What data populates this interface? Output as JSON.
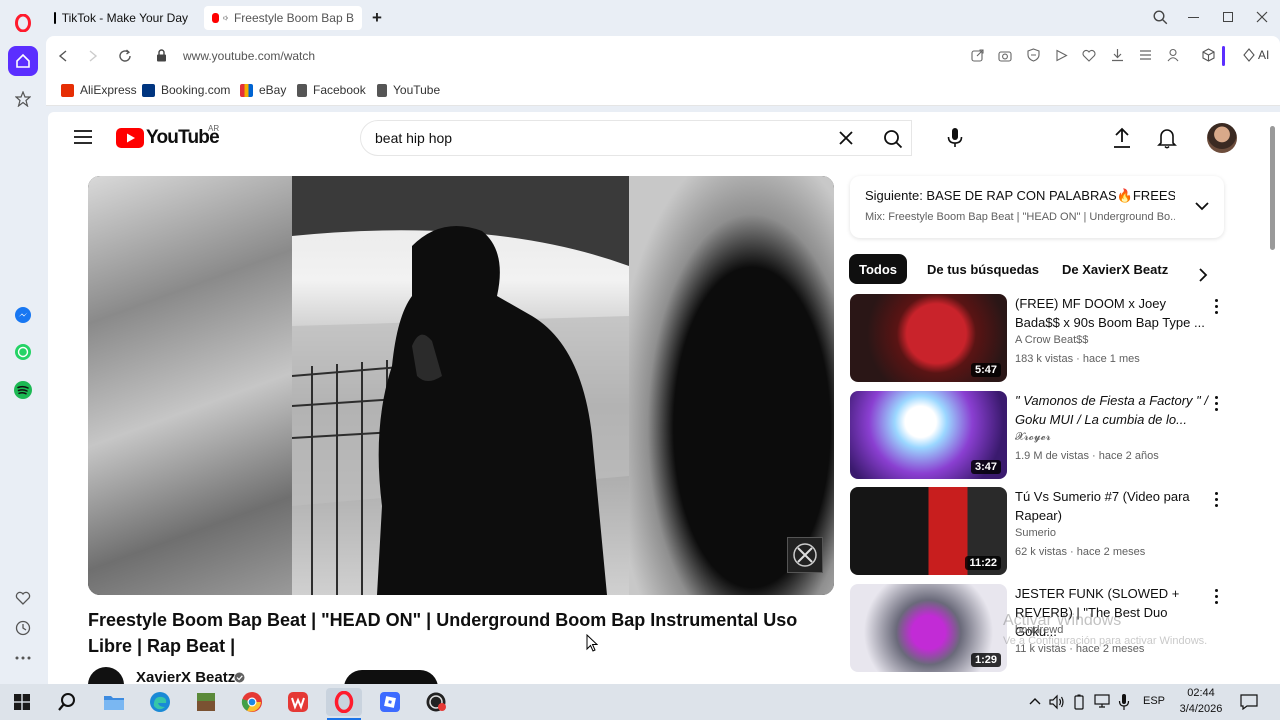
{
  "browser": {
    "tabs": [
      {
        "title": "TikTok - Make Your Day",
        "active": false
      },
      {
        "title": "Freestyle Boom Bap B",
        "active": true
      }
    ],
    "new_tab_symbol": "+",
    "url": "www.youtube.com/watch",
    "ai_label": "AI",
    "bookmarks": [
      {
        "label": "AliExpress",
        "color": "#e62e04"
      },
      {
        "label": "Booking.com",
        "color": "#003580"
      },
      {
        "label": "eBay",
        "color": "#e53238"
      },
      {
        "label": "Facebook",
        "color": "#555555"
      },
      {
        "label": "YouTube",
        "color": "#555555"
      }
    ]
  },
  "youtube": {
    "logo_text": "YouTube",
    "region": "AR",
    "search_value": "beat hip hop",
    "video_title": "Freestyle Boom Bap Beat | \"HEAD ON\" | Underground Boom Bap Instrumental Uso Libre | Rap Beat |",
    "channel_name": "XavierX Beatz",
    "next_up": {
      "label": "Siguiente: BASE DE RAP CON PALABRAS🔥FREEST...",
      "mix": "Mix: Freestyle Boom Bap Beat | \"HEAD ON\" | Underground Bo..."
    },
    "chips": [
      "Todos",
      "De tus búsquedas",
      "De XavierX Beatz"
    ],
    "recommendations": [
      {
        "title": "(FREE) MF DOOM x Joey Bada$$ x 90s Boom Bap Type ...",
        "channel": "A Crow Beat$$",
        "meta": "183 k vistas · hace 1 mes",
        "duration": "5:47",
        "colors": [
          "#2a1616",
          "#c9232b"
        ]
      },
      {
        "title": "\" Vamonos de Fiesta a Factory \" / Goku MUI / La cumbia de lo...",
        "channel": "𝓧𝓻𝓸𝔂𝓮𝓻",
        "meta": "1.9 M de vistas · hace 2 años",
        "duration": "3:47",
        "colors": [
          "#3a1a6e",
          "#9bd7ff"
        ]
      },
      {
        "title": "Tú Vs Sumerio #7 (Video para Rapear)",
        "channel": "Sumerio",
        "meta": "62 k vistas · hace 2 meses",
        "duration": "11:22",
        "colors": [
          "#111111",
          "#c81e1e"
        ]
      },
      {
        "title": "JESTER FUNK (SLOWED + REVERB) | \"The Best Duo Goku...",
        "channel": "bondrewd",
        "meta": "11 k vistas · hace 2 meses",
        "duration": "1:29",
        "colors": [
          "#e8e6ee",
          "#c22bd6"
        ]
      }
    ]
  },
  "watermark": {
    "line1": "Activar Windows",
    "line2": "Ve a Configuración para activar Windows."
  },
  "taskbar": {
    "language": "ESP",
    "time": "02:44",
    "date": "3/4/2026"
  }
}
